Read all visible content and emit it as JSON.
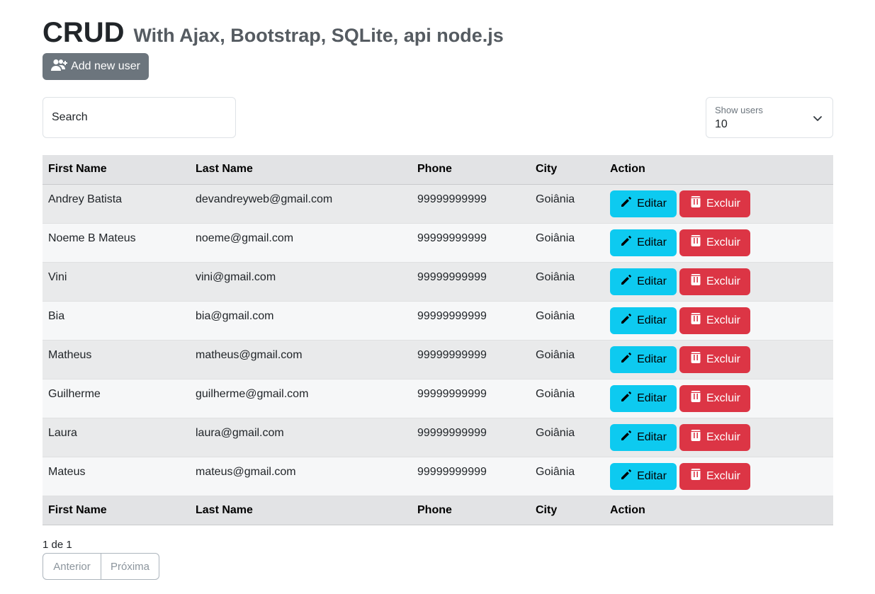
{
  "header": {
    "title": "CRUD",
    "subtitle": "With Ajax, Bootstrap, SQLite, api node.js",
    "add_button_label": "Add new user",
    "add_button_icon": "user-plus-icon"
  },
  "filters": {
    "search_placeholder": "Search",
    "show_label": "Show users",
    "show_value": "10"
  },
  "table": {
    "columns": [
      "First Name",
      "Last Name",
      "Phone",
      "City",
      "Action"
    ],
    "edit_label": "Editar",
    "delete_label": "Excluir",
    "rows": [
      {
        "first": "Andrey Batista",
        "last": "devandreyweb@gmail.com",
        "phone": "99999999999",
        "city": "Goiânia"
      },
      {
        "first": "Noeme B Mateus",
        "last": "noeme@gmail.com",
        "phone": "99999999999",
        "city": "Goiânia"
      },
      {
        "first": "Vini",
        "last": "vini@gmail.com",
        "phone": "99999999999",
        "city": "Goiânia"
      },
      {
        "first": "Bia",
        "last": "bia@gmail.com",
        "phone": "99999999999",
        "city": "Goiânia"
      },
      {
        "first": "Matheus",
        "last": "matheus@gmail.com",
        "phone": "99999999999",
        "city": "Goiânia"
      },
      {
        "first": "Guilherme",
        "last": "guilherme@gmail.com",
        "phone": "99999999999",
        "city": "Goiânia"
      },
      {
        "first": "Laura",
        "last": "laura@gmail.com",
        "phone": "99999999999",
        "city": "Goiânia"
      },
      {
        "first": "Mateus",
        "last": "mateus@gmail.com",
        "phone": "99999999999",
        "city": "Goiânia"
      }
    ]
  },
  "pagination": {
    "page_info": "1 de 1",
    "prev_label": "Anterior",
    "next_label": "Próxima"
  },
  "colors": {
    "secondary": "#6c757d",
    "info": "#0dcaf0",
    "danger": "#dc3545",
    "header_row": "#e2e3e5"
  }
}
